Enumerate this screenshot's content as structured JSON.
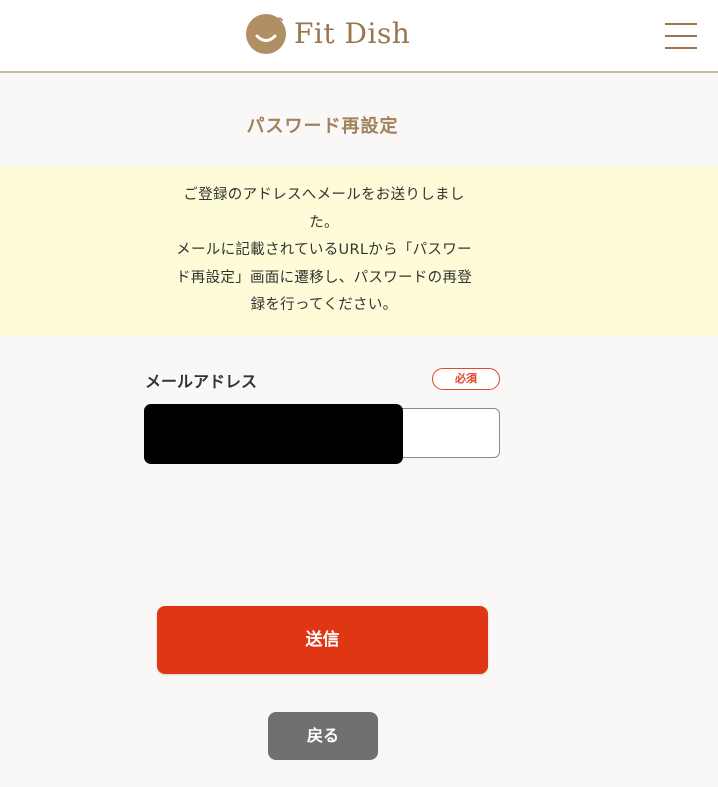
{
  "header": {
    "logo_text": "Fit Dish",
    "logo_icon": "smiling-dish-logo",
    "menu_icon": "hamburger-menu-icon"
  },
  "page": {
    "title": "パスワード再設定"
  },
  "notice": {
    "lines": [
      "ご登録のアドレスへメールをお送りしまし",
      "た。",
      "メールに記載されているURLから「パスワー",
      "ド再設定」画面に遷移し、パスワードの再登",
      "録を行ってください。"
    ]
  },
  "form": {
    "email_label": "メールアドレス",
    "required_label": "必須",
    "email_value": ""
  },
  "actions": {
    "submit_label": "送信",
    "back_label": "戻る"
  },
  "colors": {
    "brand": "#9a7650",
    "accent": "#e03613",
    "notice_bg": "#fdfbd8",
    "page_bg": "#faf8f6",
    "back_button": "#707070"
  }
}
